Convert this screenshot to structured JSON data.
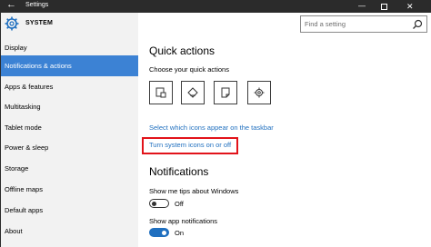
{
  "window": {
    "title": "Settings",
    "back_icon": "back-arrow-icon",
    "controls": [
      "minimize-icon",
      "maximize-icon",
      "close-icon"
    ]
  },
  "header": {
    "title": "SYSTEM",
    "icon": "gear-icon"
  },
  "search": {
    "placeholder": "Find a setting",
    "icon": "search-icon"
  },
  "sidebar": {
    "items": [
      {
        "label": "Display",
        "active": false
      },
      {
        "label": "Notifications & actions",
        "active": true
      },
      {
        "label": "Apps & features",
        "active": false
      },
      {
        "label": "Multitasking",
        "active": false
      },
      {
        "label": "Tablet mode",
        "active": false
      },
      {
        "label": "Power & sleep",
        "active": false
      },
      {
        "label": "Storage",
        "active": false
      },
      {
        "label": "Offline maps",
        "active": false
      },
      {
        "label": "Default apps",
        "active": false
      },
      {
        "label": "About",
        "active": false
      }
    ]
  },
  "main": {
    "quick_actions": {
      "heading": "Quick actions",
      "subheading": "Choose your quick actions",
      "tiles": [
        "tablet-mode-icon",
        "connect-icon",
        "note-icon",
        "settings-gear-icon"
      ]
    },
    "links": {
      "select_icons": "Select which icons appear on the taskbar",
      "turn_system_icons": "Turn system icons on or off"
    },
    "notifications": {
      "heading": "Notifications",
      "tips": {
        "label": "Show me tips about Windows",
        "state": "Off",
        "on": false
      },
      "app_notifications": {
        "label": "Show app notifications",
        "state": "On",
        "on": true
      }
    }
  },
  "colors": {
    "accent": "#3c82d4",
    "link": "#1f6fbf",
    "highlight": "#e2131a",
    "titlebar": "#2b2b2b",
    "sidebar_bg": "#f2f2f2"
  }
}
